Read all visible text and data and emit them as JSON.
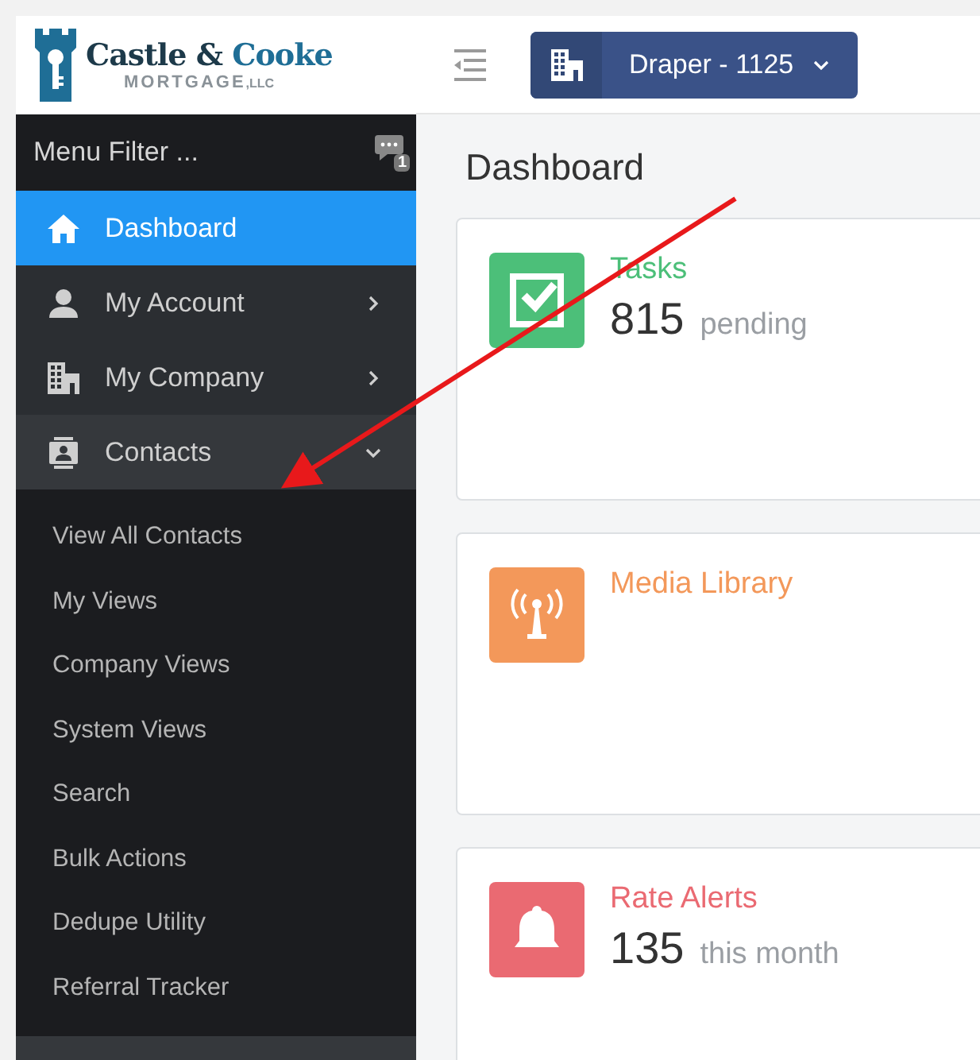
{
  "logo": {
    "brand": [
      "Castle &",
      "Cooke"
    ],
    "tagline": "MORTGAGE",
    "tagline_suffix": ",LLC"
  },
  "header": {
    "location": "Draper - 1125"
  },
  "menu_filter": {
    "placeholder": "Menu Filter ...",
    "badge": "1"
  },
  "sidebar": {
    "items": [
      {
        "label": "Dashboard",
        "kind": "link",
        "selected": true,
        "expanded": false
      },
      {
        "label": "My Account",
        "kind": "menu",
        "selected": false,
        "expanded": false
      },
      {
        "label": "My Company",
        "kind": "menu",
        "selected": false,
        "expanded": false
      },
      {
        "label": "Contacts",
        "kind": "menu",
        "selected": false,
        "expanded": true,
        "children": [
          {
            "label": "View All Contacts"
          },
          {
            "label": "My Views"
          },
          {
            "label": "Company Views"
          },
          {
            "label": "System Views"
          },
          {
            "label": "Search"
          },
          {
            "label": "Bulk Actions"
          },
          {
            "label": "Dedupe Utility"
          },
          {
            "label": "Referral Tracker"
          }
        ]
      }
    ]
  },
  "page_title": "Dashboard",
  "cards": [
    {
      "title": "Tasks",
      "count": "815",
      "unit": "pending",
      "color": "#4cbf79"
    },
    {
      "title": "Media Library",
      "color": "#f3985a"
    },
    {
      "title": "Rate Alerts",
      "count": "135",
      "unit": "this month",
      "color": "#ea6a72"
    }
  ]
}
